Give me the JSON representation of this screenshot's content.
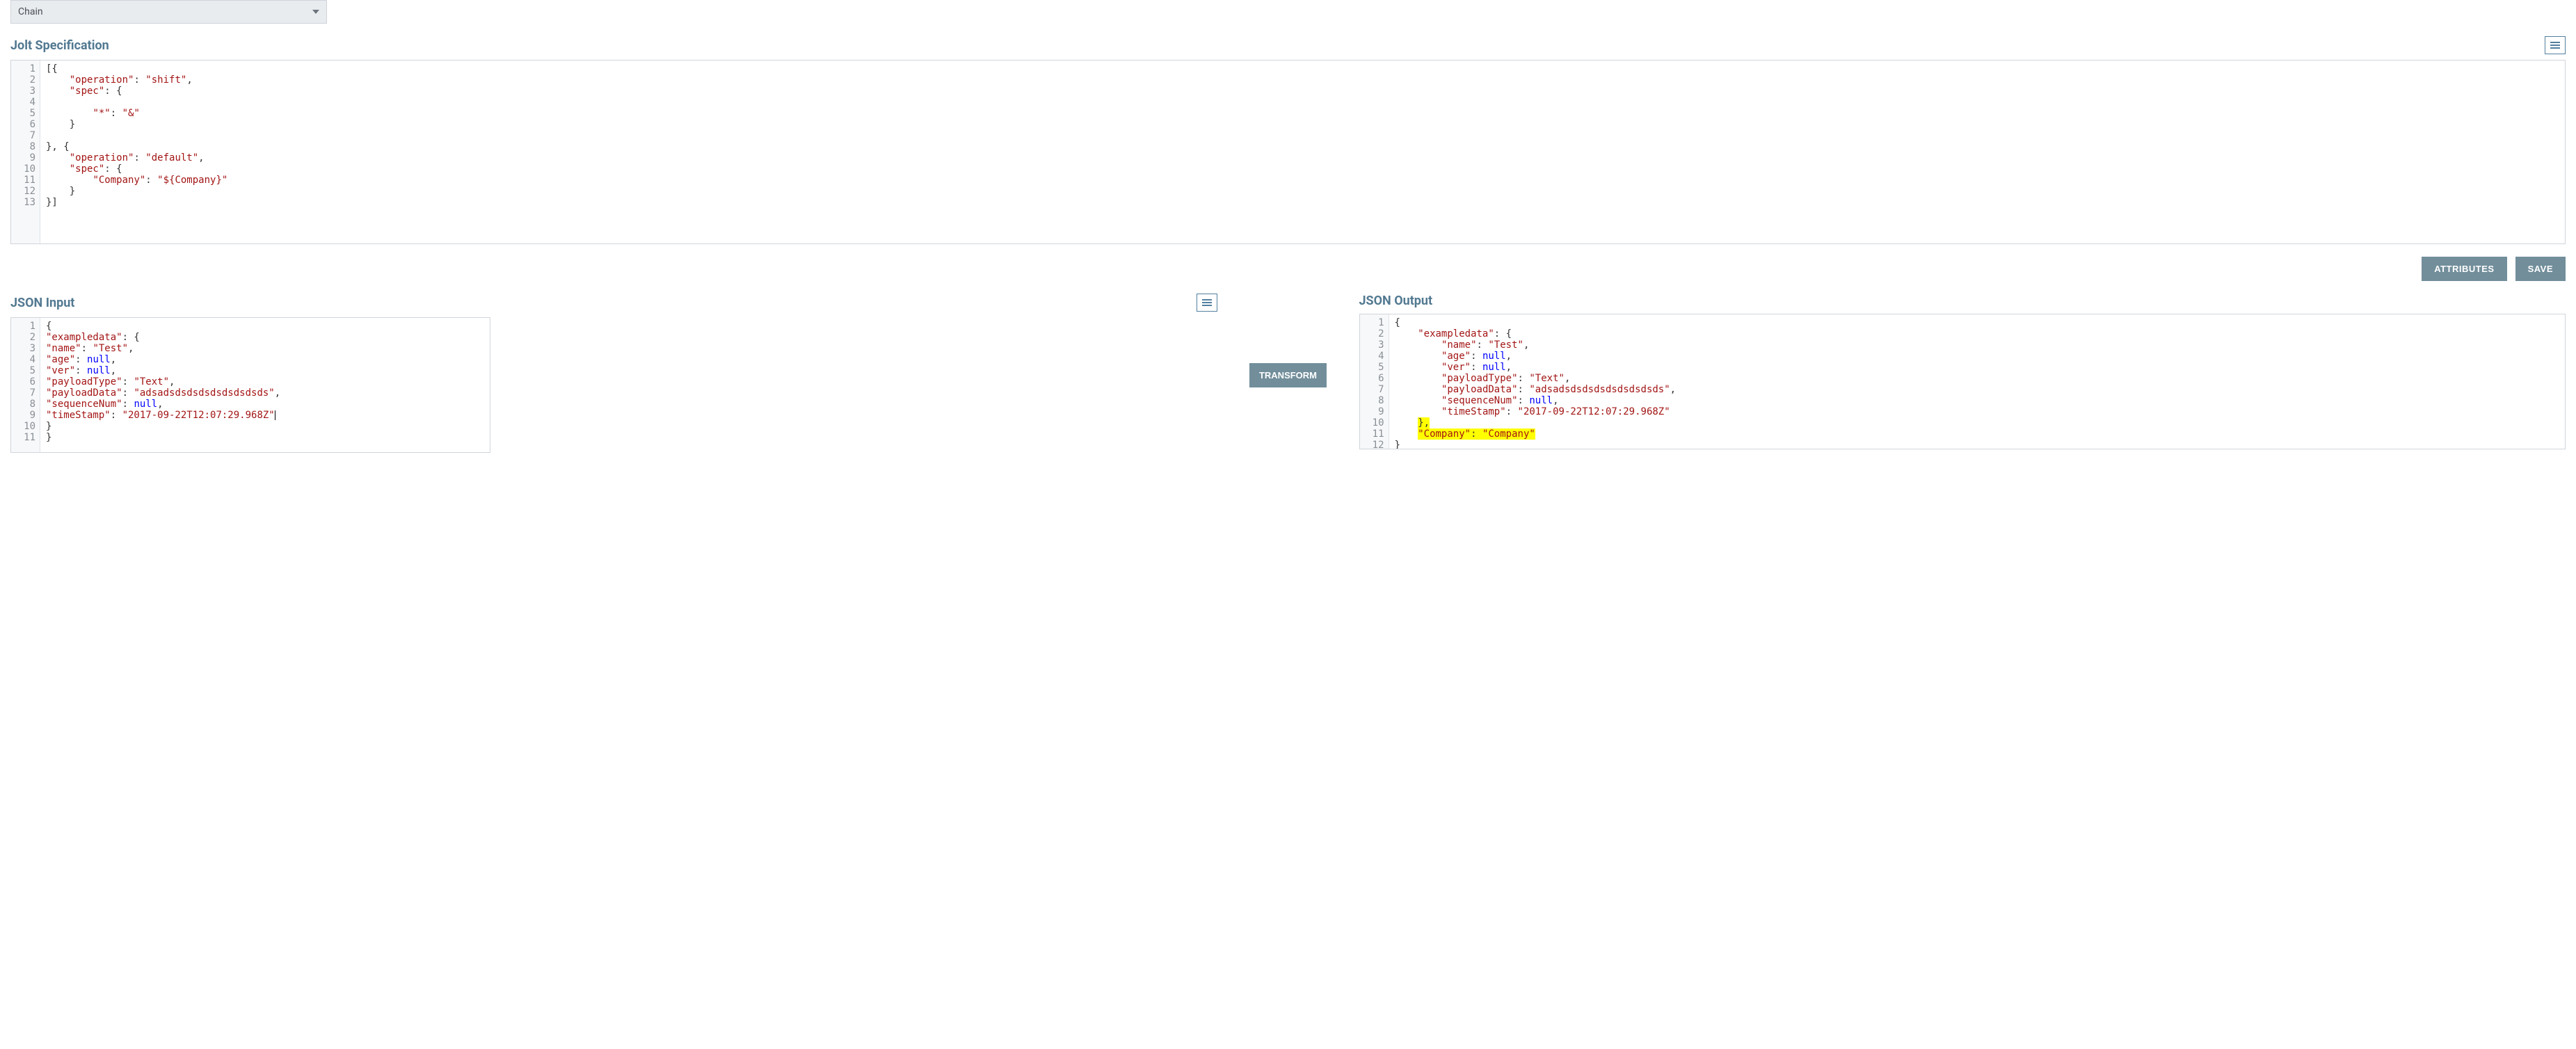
{
  "operation_select": {
    "value": "Chain"
  },
  "spec": {
    "title": "Jolt Specification",
    "lines": [
      1,
      2,
      3,
      4,
      5,
      6,
      7,
      8,
      9,
      10,
      11,
      12,
      13
    ],
    "code": [
      [
        {
          "t": "[{",
          "c": "p"
        }
      ],
      [
        {
          "t": "    ",
          "c": "p"
        },
        {
          "t": "\"operation\"",
          "c": "k"
        },
        {
          "t": ": ",
          "c": "p"
        },
        {
          "t": "\"shift\"",
          "c": "v"
        },
        {
          "t": ",",
          "c": "p"
        }
      ],
      [
        {
          "t": "    ",
          "c": "p"
        },
        {
          "t": "\"spec\"",
          "c": "k"
        },
        {
          "t": ": {",
          "c": "p"
        }
      ],
      [
        {
          "t": "",
          "c": "p"
        }
      ],
      [
        {
          "t": "        ",
          "c": "p"
        },
        {
          "t": "\"*\"",
          "c": "k"
        },
        {
          "t": ": ",
          "c": "p"
        },
        {
          "t": "\"&\"",
          "c": "v"
        }
      ],
      [
        {
          "t": "    }",
          "c": "p"
        }
      ],
      [
        {
          "t": "",
          "c": "p"
        }
      ],
      [
        {
          "t": "}, {",
          "c": "p"
        }
      ],
      [
        {
          "t": "    ",
          "c": "p"
        },
        {
          "t": "\"operation\"",
          "c": "k"
        },
        {
          "t": ": ",
          "c": "p"
        },
        {
          "t": "\"default\"",
          "c": "v"
        },
        {
          "t": ",",
          "c": "p"
        }
      ],
      [
        {
          "t": "    ",
          "c": "p"
        },
        {
          "t": "\"spec\"",
          "c": "k"
        },
        {
          "t": ": {",
          "c": "p"
        }
      ],
      [
        {
          "t": "        ",
          "c": "p"
        },
        {
          "t": "\"Company\"",
          "c": "k"
        },
        {
          "t": ": ",
          "c": "p"
        },
        {
          "t": "\"${Company}\"",
          "c": "v"
        }
      ],
      [
        {
          "t": "    }",
          "c": "p"
        }
      ],
      [
        {
          "t": "}]",
          "c": "p"
        }
      ]
    ]
  },
  "buttons": {
    "attributes": "ATTRIBUTES",
    "save": "SAVE",
    "transform": "TRANSFORM"
  },
  "input": {
    "title": "JSON Input",
    "lines": [
      1,
      2,
      3,
      4,
      5,
      6,
      7,
      8,
      9,
      10,
      11
    ],
    "code": [
      [
        {
          "t": "{",
          "c": "p"
        }
      ],
      [
        {
          "t": "\"exampledata\"",
          "c": "k"
        },
        {
          "t": ": {",
          "c": "p"
        }
      ],
      [
        {
          "t": "\"name\"",
          "c": "k"
        },
        {
          "t": ": ",
          "c": "p"
        },
        {
          "t": "\"Test\"",
          "c": "v"
        },
        {
          "t": ",",
          "c": "p"
        }
      ],
      [
        {
          "t": "\"age\"",
          "c": "k"
        },
        {
          "t": ": ",
          "c": "p"
        },
        {
          "t": "null",
          "c": "n"
        },
        {
          "t": ",",
          "c": "p"
        }
      ],
      [
        {
          "t": "\"ver\"",
          "c": "k"
        },
        {
          "t": ": ",
          "c": "p"
        },
        {
          "t": "null",
          "c": "n"
        },
        {
          "t": ",",
          "c": "p"
        }
      ],
      [
        {
          "t": "\"payloadType\"",
          "c": "k"
        },
        {
          "t": ": ",
          "c": "p"
        },
        {
          "t": "\"Text\"",
          "c": "v"
        },
        {
          "t": ",",
          "c": "p"
        }
      ],
      [
        {
          "t": "\"payloadData\"",
          "c": "k"
        },
        {
          "t": ": ",
          "c": "p"
        },
        {
          "t": "\"adsadsdsdsdsdsdsdsdsds\"",
          "c": "v"
        },
        {
          "t": ",",
          "c": "p"
        }
      ],
      [
        {
          "t": "\"sequenceNum\"",
          "c": "k"
        },
        {
          "t": ": ",
          "c": "p"
        },
        {
          "t": "null",
          "c": "n"
        },
        {
          "t": ",",
          "c": "p"
        }
      ],
      [
        {
          "t": "\"timeStamp\"",
          "c": "k"
        },
        {
          "t": ": ",
          "c": "p"
        },
        {
          "t": "\"2017-09-22T12:07:29.968Z\"",
          "c": "v"
        },
        {
          "t": "",
          "c": "p",
          "cursor": true
        }
      ],
      [
        {
          "t": "}",
          "c": "p"
        }
      ],
      [
        {
          "t": "}",
          "c": "p"
        }
      ]
    ]
  },
  "output": {
    "title": "JSON Output",
    "lines": [
      1,
      2,
      3,
      4,
      5,
      6,
      7,
      8,
      9,
      10,
      11,
      12
    ],
    "code": [
      [
        {
          "t": "{",
          "c": "p"
        }
      ],
      [
        {
          "t": "    ",
          "c": "p"
        },
        {
          "t": "\"exampledata\"",
          "c": "k"
        },
        {
          "t": ": {",
          "c": "p"
        }
      ],
      [
        {
          "t": "        ",
          "c": "p"
        },
        {
          "t": "\"name\"",
          "c": "k"
        },
        {
          "t": ": ",
          "c": "p"
        },
        {
          "t": "\"Test\"",
          "c": "v"
        },
        {
          "t": ",",
          "c": "p"
        }
      ],
      [
        {
          "t": "        ",
          "c": "p"
        },
        {
          "t": "\"age\"",
          "c": "k"
        },
        {
          "t": ": ",
          "c": "p"
        },
        {
          "t": "null",
          "c": "n"
        },
        {
          "t": ",",
          "c": "p"
        }
      ],
      [
        {
          "t": "        ",
          "c": "p"
        },
        {
          "t": "\"ver\"",
          "c": "k"
        },
        {
          "t": ": ",
          "c": "p"
        },
        {
          "t": "null",
          "c": "n"
        },
        {
          "t": ",",
          "c": "p"
        }
      ],
      [
        {
          "t": "        ",
          "c": "p"
        },
        {
          "t": "\"payloadType\"",
          "c": "k"
        },
        {
          "t": ": ",
          "c": "p"
        },
        {
          "t": "\"Text\"",
          "c": "v"
        },
        {
          "t": ",",
          "c": "p"
        }
      ],
      [
        {
          "t": "        ",
          "c": "p"
        },
        {
          "t": "\"payloadData\"",
          "c": "k"
        },
        {
          "t": ": ",
          "c": "p"
        },
        {
          "t": "\"adsadsdsdsdsdsdsdsdsds\"",
          "c": "v"
        },
        {
          "t": ",",
          "c": "p"
        }
      ],
      [
        {
          "t": "        ",
          "c": "p"
        },
        {
          "t": "\"sequenceNum\"",
          "c": "k"
        },
        {
          "t": ": ",
          "c": "p"
        },
        {
          "t": "null",
          "c": "n"
        },
        {
          "t": ",",
          "c": "p"
        }
      ],
      [
        {
          "t": "        ",
          "c": "p"
        },
        {
          "t": "\"timeStamp\"",
          "c": "k"
        },
        {
          "t": ": ",
          "c": "p"
        },
        {
          "t": "\"2017-09-22T12:07:29.968Z\"",
          "c": "v"
        }
      ],
      [
        {
          "t": "    ",
          "c": "p"
        },
        {
          "t": "},",
          "c": "p",
          "hl": true
        }
      ],
      [
        {
          "t": "    ",
          "c": "p"
        },
        {
          "t": "\"Company\"",
          "c": "k",
          "hl": true
        },
        {
          "t": ": ",
          "c": "p",
          "hl": true
        },
        {
          "t": "\"Company\"",
          "c": "v",
          "hl": true
        }
      ],
      [
        {
          "t": "}",
          "c": "p"
        }
      ]
    ]
  }
}
